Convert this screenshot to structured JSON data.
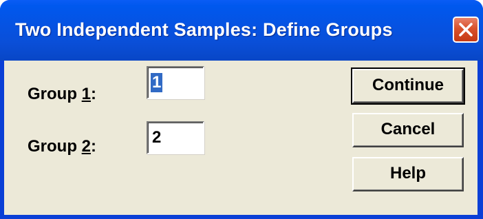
{
  "window": {
    "title": "Two Independent Samples: Define Groups"
  },
  "group1": {
    "label_prefix": "Group ",
    "label_accel": "1",
    "label_suffix": ":",
    "value": "1"
  },
  "group2": {
    "label_prefix": "Group ",
    "label_accel": "2",
    "label_suffix": ":",
    "value": "2"
  },
  "buttons": {
    "continue_label": "Continue",
    "cancel_label": "Cancel",
    "help_label": "Help"
  },
  "icons": {
    "close": "close-icon"
  },
  "colors": {
    "titlebar": "#0553e3",
    "client": "#ece9d8",
    "close_button": "#d8522c",
    "selection": "#316ac5"
  }
}
